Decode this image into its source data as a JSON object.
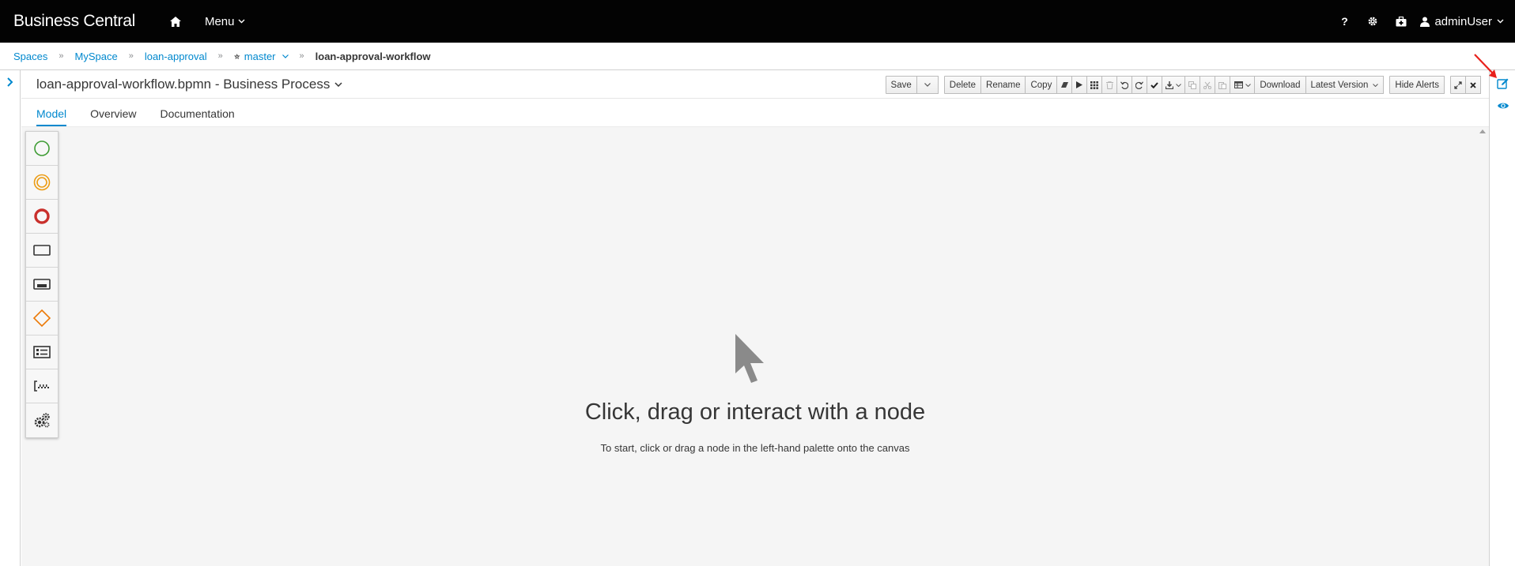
{
  "app": {
    "brand": "Business Central"
  },
  "topbar": {
    "menu_label": "Menu",
    "help_label": "?",
    "user_label": "adminUser"
  },
  "breadcrumb": {
    "items": [
      "Spaces",
      "MySpace",
      "loan-approval",
      "master",
      "loan-approval-workflow"
    ]
  },
  "editor": {
    "title": "loan-approval-workflow.bpmn - Business Process",
    "toolbar": {
      "save": "Save",
      "delete": "Delete",
      "rename": "Rename",
      "copy": "Copy",
      "download": "Download",
      "latest_version": "Latest Version",
      "hide_alerts": "Hide Alerts"
    },
    "tabs": [
      "Model",
      "Overview",
      "Documentation"
    ],
    "active_tab": "Model"
  },
  "canvas": {
    "empty_title": "Click, drag or interact with a node",
    "empty_subtitle": "To start, click or drag a node in the left-hand palette onto the canvas"
  },
  "palette": {
    "items": [
      "start-event-icon",
      "intermediate-event-icon",
      "end-event-icon",
      "task-icon",
      "subprocess-icon",
      "gateway-icon",
      "lane-icon",
      "custom-tasks-icon",
      "service-tasks-icon"
    ]
  },
  "colors": {
    "accent": "#0088ce",
    "start_event": "#3f9c35",
    "intermediate_event": "#ec9c13",
    "end_event": "#c9302c",
    "gateway": "#ec7a08",
    "annotation": "#e8211c"
  }
}
